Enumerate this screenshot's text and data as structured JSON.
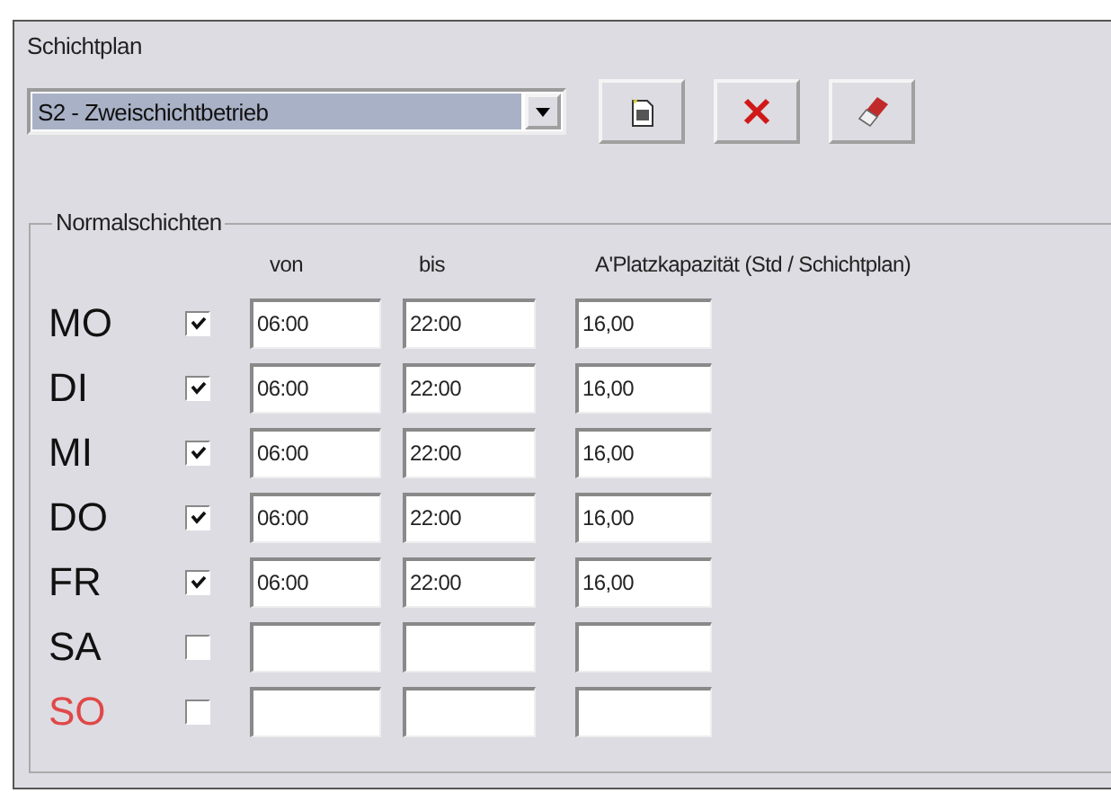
{
  "section_title": "Schichtplan",
  "plan_dropdown": {
    "value": "S2 - Zweischichtbetrieb"
  },
  "toolbar": [
    {
      "kind": "new"
    },
    {
      "kind": "delete"
    },
    {
      "kind": "erase"
    }
  ],
  "group": {
    "title": "Normalschichten",
    "columns": [
      "von",
      "bis",
      "A'Platzkapazität (Std / Schichtplan)"
    ],
    "rows": [
      {
        "day": "MO",
        "color": "#111111",
        "checked": true,
        "von": "06:00",
        "bis": "22:00",
        "capacity": "16,00"
      },
      {
        "day": "DI",
        "color": "#111111",
        "checked": true,
        "von": "06:00",
        "bis": "22:00",
        "capacity": "16,00"
      },
      {
        "day": "MI",
        "color": "#111111",
        "checked": true,
        "von": "06:00",
        "bis": "22:00",
        "capacity": "16,00"
      },
      {
        "day": "DO",
        "color": "#111111",
        "checked": true,
        "von": "06:00",
        "bis": "22:00",
        "capacity": "16,00"
      },
      {
        "day": "FR",
        "color": "#111111",
        "checked": true,
        "von": "06:00",
        "bis": "22:00",
        "capacity": "16,00"
      },
      {
        "day": "SA",
        "color": "#111111",
        "checked": false
      },
      {
        "day": "SO",
        "color": "#e04848",
        "checked": false
      }
    ]
  }
}
